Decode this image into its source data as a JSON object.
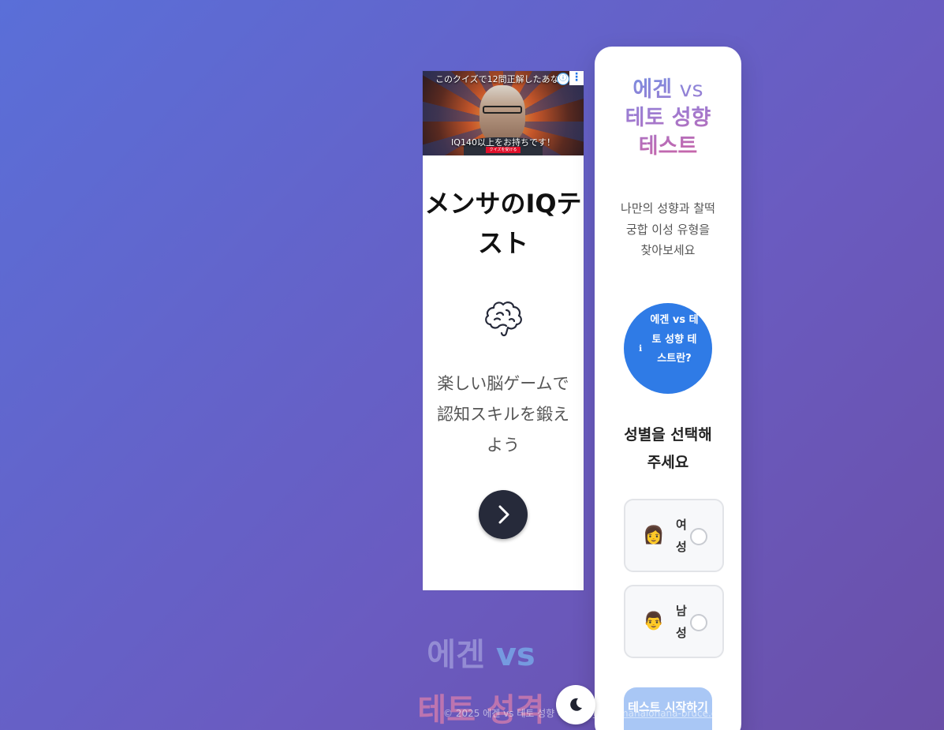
{
  "ad": {
    "banner_top_text": "このクイズで12問正解したあなた",
    "banner_bottom_text": "IQ140以上をお持ちです！",
    "banner_cta_text": "クイズを受ける",
    "info_icon": "ⓘ",
    "menu_icon": "⋮",
    "title": "メンサのIQテスト",
    "brain_icon": "brain-icon",
    "description": "楽しい脳ゲームで認知スキルを鍛えよう",
    "next_icon": "chevron-right-icon"
  },
  "card": {
    "title_part1": "에겐",
    "title_vs": "vs",
    "title_part2": "테토 성향 테스트",
    "subtitle": "나만의 성향과 찰떡궁합 이성 유형을 찾아보세요",
    "info_button": {
      "icon": "ℹ",
      "label": "에겐 vs 테토 성향 테스트란?"
    },
    "gender_heading": "성별을 선택해주세요",
    "options": [
      {
        "emoji": "👩",
        "label": "여성",
        "selected": false
      },
      {
        "emoji": "👨",
        "label": "남성",
        "selected": false
      }
    ],
    "start_button": "테스트 시작하기"
  },
  "background_title": {
    "line1": "에겐",
    "vs": "vs",
    "line2": "테토 성격"
  },
  "footer": {
    "text": "© 2025 에겐 vs 테토 성향 테스트 | ",
    "link": "tests.mahalohana-bruce.com"
  },
  "theme_toggle": {
    "icon": "moon-icon"
  },
  "colors": {
    "primary": "#2f7be6",
    "start_disabled": "#a9c7f5",
    "background_start": "#5a6fd8",
    "background_end": "#6a4fa8"
  }
}
